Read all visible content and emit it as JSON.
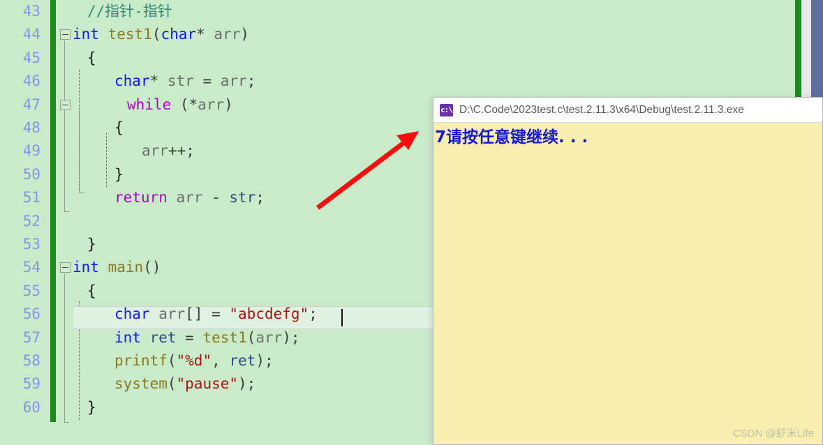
{
  "editor": {
    "name": "visual-studio-code-editor",
    "background_color": "#c9ebc9",
    "change_bar_color": "#1e8a1e",
    "line_number_color": "#8a92e8",
    "first_line_number": 43,
    "lines": [
      {
        "num": "43",
        "indent": 1,
        "segments": [
          {
            "text": "//指针-指针",
            "cls": "t-com"
          }
        ]
      },
      {
        "num": "44",
        "indent": 0,
        "fold": "open",
        "segments": [
          {
            "text": "int",
            "cls": "t-kw"
          },
          {
            "text": " ",
            "cls": "t-pun"
          },
          {
            "text": "test1",
            "cls": "t-fn"
          },
          {
            "text": "(",
            "cls": "t-pun"
          },
          {
            "text": "char",
            "cls": "t-kw"
          },
          {
            "text": "* ",
            "cls": "t-pun"
          },
          {
            "text": "arr",
            "cls": "t-id"
          },
          {
            "text": ")",
            "cls": "t-pun"
          }
        ]
      },
      {
        "num": "45",
        "indent": 1,
        "segments": [
          {
            "text": "{",
            "cls": "t-brace"
          }
        ]
      },
      {
        "num": "46",
        "indent": 2,
        "segments": [
          {
            "text": "char",
            "cls": "t-kw"
          },
          {
            "text": "* ",
            "cls": "t-pun"
          },
          {
            "text": "str",
            "cls": "t-id"
          },
          {
            "text": " = ",
            "cls": "t-pun"
          },
          {
            "text": "arr",
            "cls": "t-id"
          },
          {
            "text": ";",
            "cls": "t-pun"
          }
        ]
      },
      {
        "num": "47",
        "indent": 2,
        "fold": "open",
        "segments": [
          {
            "text": "while",
            "cls": "t-ctrl"
          },
          {
            "text": " (*",
            "cls": "t-pun"
          },
          {
            "text": "arr",
            "cls": "t-id"
          },
          {
            "text": ")",
            "cls": "t-pun"
          }
        ]
      },
      {
        "num": "48",
        "indent": 2,
        "segments": [
          {
            "text": "{",
            "cls": "t-brace"
          }
        ]
      },
      {
        "num": "49",
        "indent": 3,
        "segments": [
          {
            "text": "arr",
            "cls": "t-id"
          },
          {
            "text": "++;",
            "cls": "t-pun"
          }
        ]
      },
      {
        "num": "50",
        "indent": 2,
        "segments": [
          {
            "text": "}",
            "cls": "t-brace"
          }
        ]
      },
      {
        "num": "51",
        "indent": 2,
        "segments": [
          {
            "text": "return",
            "cls": "t-ctrl"
          },
          {
            "text": " ",
            "cls": "t-pun"
          },
          {
            "text": "arr",
            "cls": "t-id"
          },
          {
            "text": " - ",
            "cls": "t-pun"
          },
          {
            "text": "str",
            "cls": "t-var"
          },
          {
            "text": ";",
            "cls": "t-pun"
          }
        ]
      },
      {
        "num": "52",
        "indent": 2,
        "segments": []
      },
      {
        "num": "53",
        "indent": 1,
        "segments": [
          {
            "text": "}",
            "cls": "t-brace"
          }
        ]
      },
      {
        "num": "54",
        "indent": 0,
        "fold": "open",
        "segments": [
          {
            "text": "int",
            "cls": "t-kw"
          },
          {
            "text": " ",
            "cls": "t-pun"
          },
          {
            "text": "main",
            "cls": "t-fn"
          },
          {
            "text": "()",
            "cls": "t-pun"
          }
        ]
      },
      {
        "num": "55",
        "indent": 1,
        "segments": [
          {
            "text": "{",
            "cls": "t-brace"
          }
        ]
      },
      {
        "num": "56",
        "indent": 2,
        "current": true,
        "segments": [
          {
            "text": "char",
            "cls": "t-kw"
          },
          {
            "text": " ",
            "cls": "t-pun"
          },
          {
            "text": "arr",
            "cls": "t-id"
          },
          {
            "text": "[] = ",
            "cls": "t-pun"
          },
          {
            "text": "\"abcdefg\"",
            "cls": "t-str"
          },
          {
            "text": ";",
            "cls": "t-pun"
          }
        ]
      },
      {
        "num": "57",
        "indent": 2,
        "segments": [
          {
            "text": "int",
            "cls": "t-kw"
          },
          {
            "text": " ",
            "cls": "t-pun"
          },
          {
            "text": "ret",
            "cls": "t-var"
          },
          {
            "text": " = ",
            "cls": "t-pun"
          },
          {
            "text": "test1",
            "cls": "t-fn"
          },
          {
            "text": "(",
            "cls": "t-pun"
          },
          {
            "text": "arr",
            "cls": "t-id"
          },
          {
            "text": ");",
            "cls": "t-pun"
          }
        ]
      },
      {
        "num": "58",
        "indent": 2,
        "segments": [
          {
            "text": "printf",
            "cls": "t-fn"
          },
          {
            "text": "(",
            "cls": "t-pun"
          },
          {
            "text": "\"%d\"",
            "cls": "t-str"
          },
          {
            "text": ", ",
            "cls": "t-pun"
          },
          {
            "text": "ret",
            "cls": "t-var"
          },
          {
            "text": ");",
            "cls": "t-pun"
          }
        ]
      },
      {
        "num": "59",
        "indent": 2,
        "segments": [
          {
            "text": "system",
            "cls": "t-fn"
          },
          {
            "text": "(",
            "cls": "t-pun"
          },
          {
            "text": "\"pause\"",
            "cls": "t-str"
          },
          {
            "text": ");",
            "cls": "t-pun"
          }
        ]
      },
      {
        "num": "60",
        "indent": 1,
        "segments": [
          {
            "text": "}",
            "cls": "t-brace"
          }
        ]
      }
    ]
  },
  "scrollbar": {
    "track_color": "#e7e7ec",
    "thumb_color": "#5d6f9e"
  },
  "annotation": {
    "arrow_color": "#fc0d0d",
    "description": "red-arrow-pointing-to-console-output"
  },
  "console": {
    "title": "D:\\C.Code\\2023test.c\\test.2.11.3\\x64\\Debug\\test.2.11.3.exe",
    "icon": "console-app-icon",
    "icon_glyph": "c:\\",
    "background_color": "#f7efb0",
    "text_color": "#1616d8",
    "output_lines": [
      "7请按任意键继续. . ."
    ]
  },
  "watermark": {
    "text": "CSDN @虾米Life"
  }
}
